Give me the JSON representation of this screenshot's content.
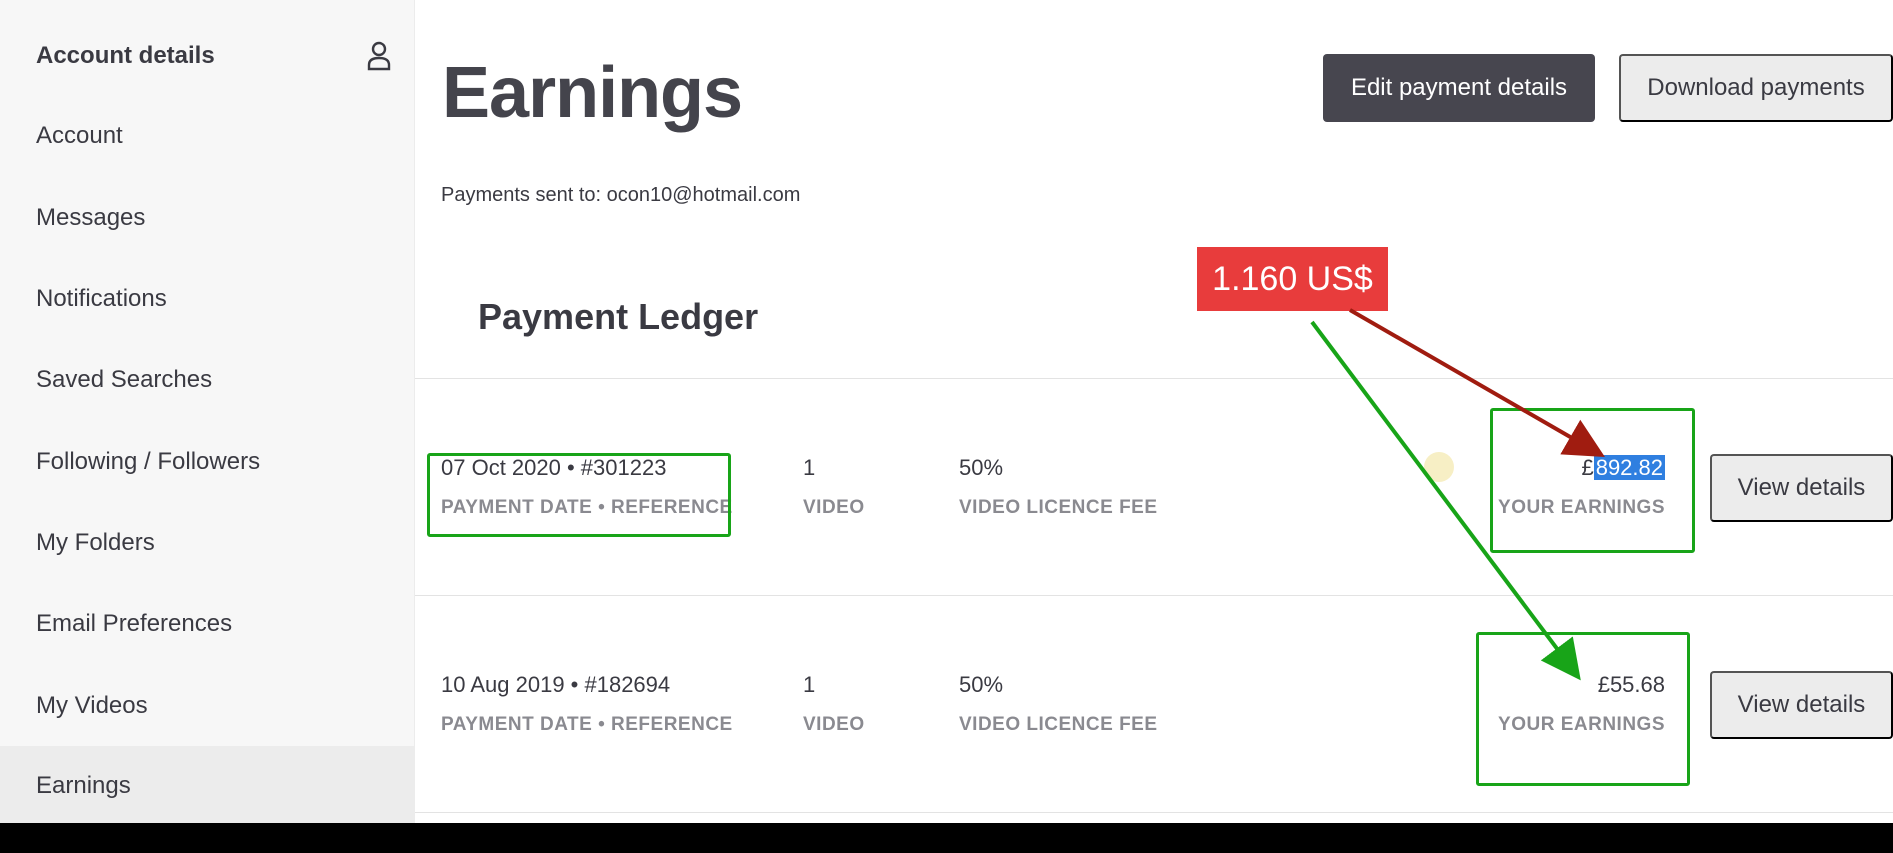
{
  "sidebar": {
    "header": "Account details",
    "items": [
      {
        "label": "Account"
      },
      {
        "label": "Messages"
      },
      {
        "label": "Notifications"
      },
      {
        "label": "Saved Searches"
      },
      {
        "label": "Following / Followers"
      },
      {
        "label": "My Folders"
      },
      {
        "label": "Email Preferences"
      },
      {
        "label": "My Videos"
      },
      {
        "label": "Earnings"
      }
    ]
  },
  "main": {
    "title": "Earnings",
    "edit_button": "Edit payment details",
    "download_button": "Download payments",
    "sent_to": "Payments sent to: ocon10@hotmail.com",
    "ledger_title": "Payment Ledger",
    "rows": [
      {
        "date_ref": "07 Oct 2020 • #301223",
        "date_ref_label": "PAYMENT DATE • REFERENCE",
        "count": "1",
        "count_label": "VIDEO",
        "fee": "50%",
        "fee_label": "VIDEO LICENCE FEE",
        "earnings_currency": "£",
        "earnings_value": "892.82",
        "earnings_label": "YOUR EARNINGS",
        "view_button": "View details"
      },
      {
        "date_ref": "10 Aug 2019 • #182694",
        "date_ref_label": "PAYMENT DATE • REFERENCE",
        "count": "1",
        "count_label": "VIDEO",
        "fee": "50%",
        "fee_label": "VIDEO LICENCE FEE",
        "earnings_value": "£55.68",
        "earnings_label": "YOUR EARNINGS",
        "view_button": "View details"
      }
    ]
  },
  "annotation": {
    "price_tag": "1.160 US$"
  },
  "colors": {
    "primary_button": "#47464f",
    "selection_highlight": "#2f7fe0",
    "annotation_green": "#18a418",
    "annotation_red": "#e83c3c",
    "arrow_dark_red": "#a01c10"
  },
  "icons": {
    "account": "user-outline-icon"
  }
}
